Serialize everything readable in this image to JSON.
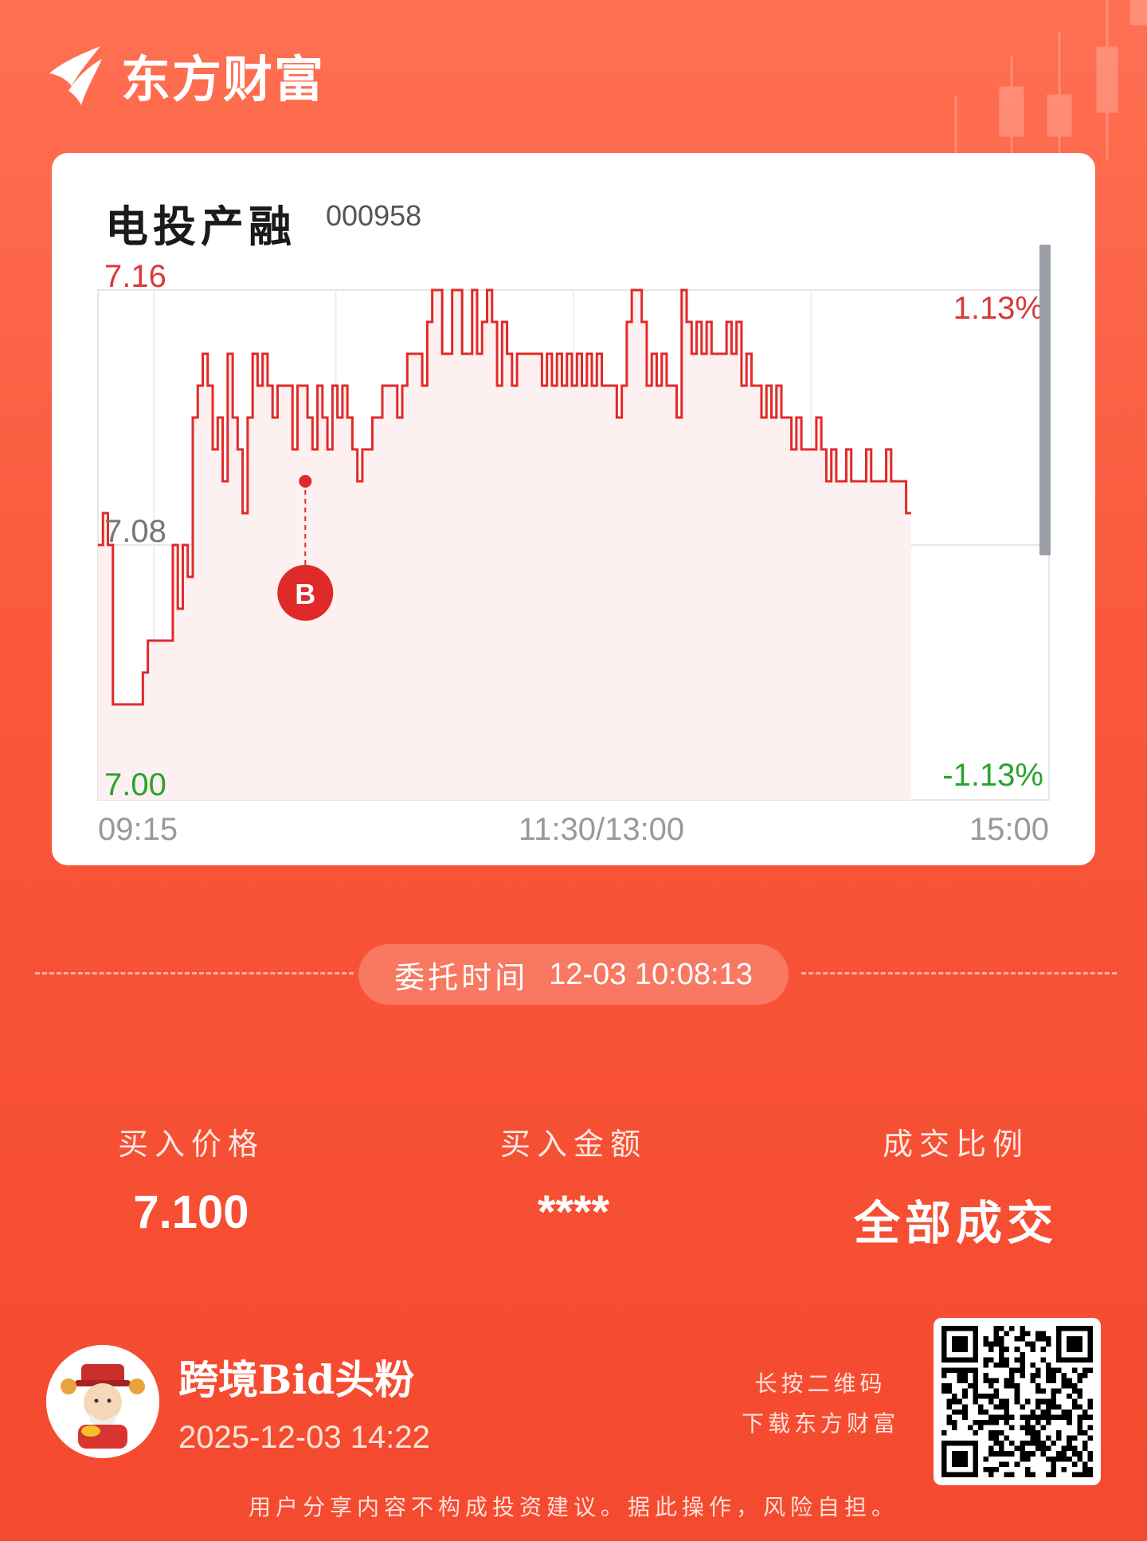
{
  "brand": {
    "name": "东方财富",
    "logo_icon": "eastmoney-logo-icon"
  },
  "stock": {
    "name": "电投产融",
    "code": "000958"
  },
  "chart_data": {
    "type": "line",
    "y_ticks": {
      "high": "7.16",
      "mid": "7.08",
      "low": "7.00"
    },
    "pct_ticks": {
      "high": "1.13%",
      "low": "-1.13%"
    },
    "x_ticks": [
      "09:15",
      "11:30/13:00",
      "15:00"
    ],
    "ylim": [
      7.0,
      7.16
    ],
    "colors": {
      "line": "#e02a2a",
      "fill": "#fdf0f0",
      "up": "#d83a3a",
      "down": "#2aa32a",
      "mid": "#777777"
    },
    "marker": {
      "label": "B",
      "x_fraction": 0.218,
      "price": 7.1
    },
    "x_fraction_end": 0.855,
    "prices": [
      7.08,
      7.09,
      7.08,
      7.03,
      7.03,
      7.03,
      7.03,
      7.03,
      7.03,
      7.04,
      7.05,
      7.05,
      7.05,
      7.05,
      7.05,
      7.08,
      7.06,
      7.08,
      7.07,
      7.12,
      7.13,
      7.14,
      7.13,
      7.11,
      7.12,
      7.1,
      7.14,
      7.12,
      7.11,
      7.09,
      7.12,
      7.14,
      7.13,
      7.14,
      7.13,
      7.12,
      7.13,
      7.13,
      7.13,
      7.11,
      7.13,
      7.13,
      7.12,
      7.11,
      7.13,
      7.12,
      7.11,
      7.13,
      7.12,
      7.13,
      7.12,
      7.11,
      7.1,
      7.11,
      7.11,
      7.12,
      7.12,
      7.13,
      7.13,
      7.13,
      7.12,
      7.13,
      7.14,
      7.14,
      7.14,
      7.13,
      7.15,
      7.16,
      7.16,
      7.14,
      7.14,
      7.16,
      7.16,
      7.14,
      7.14,
      7.16,
      7.14,
      7.15,
      7.16,
      7.15,
      7.13,
      7.15,
      7.14,
      7.13,
      7.14,
      7.14,
      7.14,
      7.14,
      7.14,
      7.13,
      7.14,
      7.13,
      7.14,
      7.13,
      7.14,
      7.13,
      7.14,
      7.13,
      7.14,
      7.13,
      7.14,
      7.13,
      7.13,
      7.13,
      7.12,
      7.13,
      7.15,
      7.16,
      7.16,
      7.15,
      7.13,
      7.14,
      7.13,
      7.14,
      7.13,
      7.13,
      7.12,
      7.16,
      7.15,
      7.14,
      7.15,
      7.14,
      7.15,
      7.14,
      7.14,
      7.14,
      7.15,
      7.14,
      7.15,
      7.13,
      7.14,
      7.13,
      7.13,
      7.12,
      7.13,
      7.12,
      7.13,
      7.12,
      7.12,
      7.11,
      7.12,
      7.11,
      7.11,
      7.11,
      7.12,
      7.11,
      7.1,
      7.11,
      7.1,
      7.1,
      7.11,
      7.1,
      7.1,
      7.1,
      7.11,
      7.1,
      7.1,
      7.1,
      7.11,
      7.1,
      7.1,
      7.1,
      7.09,
      7.09
    ]
  },
  "order": {
    "time_label": "委托时间",
    "time_value": "12-03 10:08:13"
  },
  "stats": [
    {
      "label": "买入价格",
      "value": "7.100"
    },
    {
      "label": "买入金额",
      "value": "****"
    },
    {
      "label": "成交比例",
      "value": "全部成交"
    }
  ],
  "user": {
    "name": "跨境Bid头粉",
    "time": "2025-12-03 14:22",
    "avatar_icon": "caishen-avatar-icon"
  },
  "qr": {
    "hint_line1": "长按二维码",
    "hint_line2": "下载东方财富",
    "icon": "qr-code-icon"
  },
  "disclaimer": "用户分享内容不构成投资建议。据此操作，风险自担。"
}
